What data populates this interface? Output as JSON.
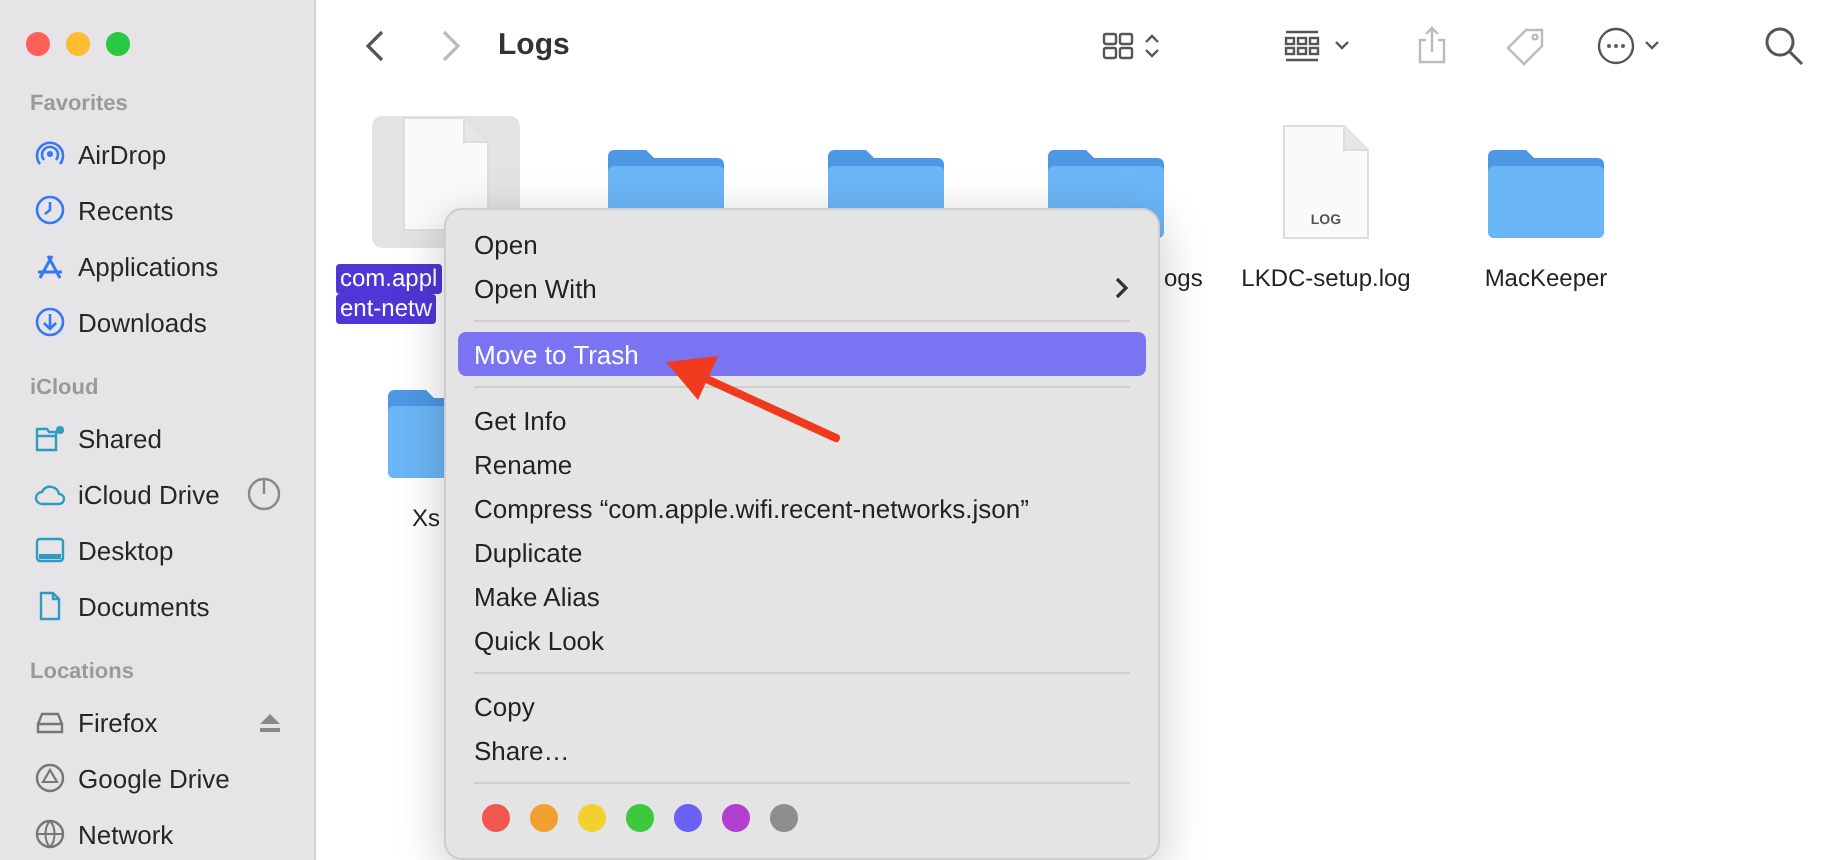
{
  "window": {
    "title": "Logs"
  },
  "toolbar": {
    "nav": [
      {
        "disabled": false
      },
      {
        "disabled": true
      }
    ],
    "actions": [
      {
        "disabled": false
      },
      {
        "disabled": false
      },
      {
        "disabled": true
      },
      {
        "disabled": true
      },
      {
        "disabled": false
      },
      {
        "disabled": false
      }
    ]
  },
  "sidebar": {
    "sections": [
      {
        "title": "Favorites",
        "items": [
          {
            "label": "AirDrop"
          },
          {
            "label": "Recents"
          },
          {
            "label": "Applications"
          },
          {
            "label": "Downloads"
          }
        ]
      },
      {
        "title": "iCloud",
        "items": [
          {
            "label": "Shared"
          },
          {
            "label": "iCloud Drive"
          },
          {
            "label": "Desktop"
          },
          {
            "label": "Documents"
          }
        ]
      },
      {
        "title": "Locations",
        "items": [
          {
            "label": "Firefox"
          },
          {
            "label": "Google Drive"
          },
          {
            "label": "Network"
          }
        ]
      }
    ]
  },
  "files": [
    {
      "kind": "file",
      "label_lines": [
        "com.appl",
        "ent-netw"
      ],
      "selected": true
    },
    {
      "kind": "folder",
      "selected": false
    },
    {
      "kind": "folder",
      "selected": false
    },
    {
      "kind": "folder",
      "label_lines": [
        "ogs"
      ],
      "selected": false
    },
    {
      "kind": "log",
      "badge": "LOG",
      "label_lines": [
        "LKDC-setup.log"
      ],
      "selected": false
    },
    {
      "kind": "folder",
      "label_lines": [
        "MacKeeper"
      ],
      "selected": false
    },
    {
      "kind": "folder",
      "label_lines": [
        "Xs"
      ],
      "selected": false
    }
  ],
  "context_menu": [
    {
      "kind": "item",
      "label": "Open",
      "selected": false
    },
    {
      "kind": "item",
      "label": "Open With",
      "submenu": true,
      "selected": false
    },
    {
      "kind": "separator"
    },
    {
      "kind": "item",
      "label": "Move to Trash",
      "selected": true
    },
    {
      "kind": "separator"
    },
    {
      "kind": "item",
      "label": "Get Info",
      "selected": false
    },
    {
      "kind": "item",
      "label": "Rename",
      "selected": false
    },
    {
      "kind": "item",
      "label": "Compress “com.apple.wifi.recent-networks.json”",
      "selected": false
    },
    {
      "kind": "item",
      "label": "Duplicate",
      "selected": false
    },
    {
      "kind": "item",
      "label": "Make Alias",
      "selected": false
    },
    {
      "kind": "item",
      "label": "Quick Look",
      "selected": false
    },
    {
      "kind": "separator"
    },
    {
      "kind": "item",
      "label": "Copy",
      "selected": false
    },
    {
      "kind": "item",
      "label": "Share…",
      "selected": false
    },
    {
      "kind": "separator"
    },
    {
      "kind": "tags",
      "tags": [
        {
          "color": "#f0574f"
        },
        {
          "color": "#f0a030"
        },
        {
          "color": "#f2d030"
        },
        {
          "color": "#3dc93d"
        },
        {
          "color": "#6b62f5"
        },
        {
          "color": "#b23fd0"
        },
        {
          "color": "#8e8e8e"
        }
      ]
    }
  ],
  "annotation": {
    "kind": "arrow"
  }
}
